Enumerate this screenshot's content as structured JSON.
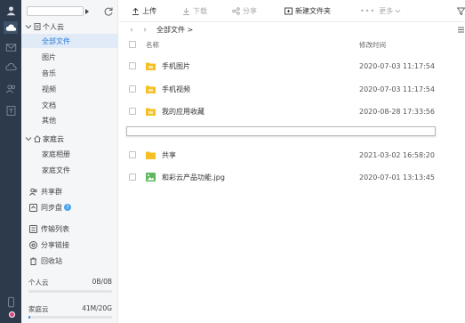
{
  "sidebar": {
    "personal_cloud": "个人云",
    "personal_items": [
      "全部文件",
      "图片",
      "音乐",
      "视频",
      "文档",
      "其他"
    ],
    "family_cloud": "家庭云",
    "family_items": [
      "家庭相册",
      "家庭文件"
    ],
    "share_group": "共享群",
    "sync_disk": "同步盘",
    "help_glyph": "?",
    "transfer_list": "传输列表",
    "share_links": "分享链接",
    "recycle_bin": "回收站",
    "quota_personal_label": "个人云",
    "quota_personal_value": "0B/0B",
    "quota_personal_fraction": 0,
    "quota_family_label": "家庭云",
    "quota_family_value": "41M/20G",
    "quota_family_fraction": 0.01
  },
  "toolbar": {
    "upload": "上传",
    "download": "下载",
    "share": "分享",
    "new_folder": "新建文件夹",
    "more": "更多"
  },
  "path": {
    "crumb": "全部文件 >"
  },
  "table": {
    "col_name": "名称",
    "col_modified": "修改时间",
    "rows": [
      {
        "name": "手机图片",
        "date": "2020-07-03 11:17:54",
        "type": "folder"
      },
      {
        "name": "手机视频",
        "date": "2020-07-03 11:17:54",
        "type": "folder"
      },
      {
        "name": "我的应用收藏",
        "date": "2020-08-28 17:33:56",
        "type": "folder"
      },
      {
        "name": "共享",
        "date": "2021-03-02 16:58:20",
        "type": "folder"
      },
      {
        "name": "和彩云产品功能.jpg",
        "date": "2020-07-01 13:13:45",
        "type": "image"
      }
    ]
  },
  "colors": {
    "accent": "#2779d9",
    "rail": "#2c3a4b",
    "folder": "#f5c024",
    "image": "#5cb85c"
  }
}
